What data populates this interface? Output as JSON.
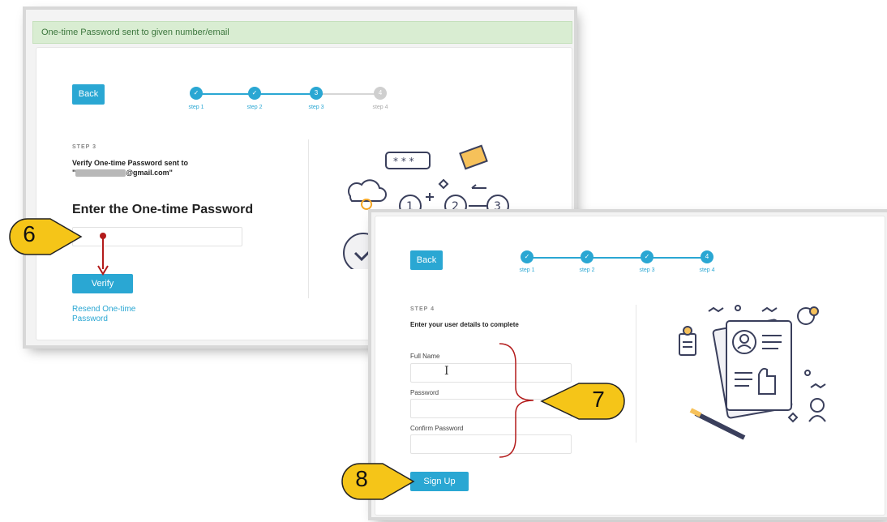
{
  "window1": {
    "alert_text": "One-time Password sent to given number/email",
    "back_label": "Back",
    "steps": [
      {
        "label": "step 1",
        "state": "done"
      },
      {
        "label": "step 2",
        "state": "done"
      },
      {
        "label": "step 3",
        "state": "current",
        "num": "3"
      },
      {
        "label": "step 4",
        "state": "todo",
        "num": "4"
      }
    ],
    "step_heading": "STEP 3",
    "verify_line1": "Verify One-time Password sent to",
    "verify_line2_suffix": "@gmail.com\"",
    "verify_line2_prefix": "\"",
    "title": "Enter the One-time Password",
    "otp_value": "",
    "verify_label": "Verify",
    "resend_label": "Resend One-time Password"
  },
  "window2": {
    "back_label": "Back",
    "steps": [
      {
        "label": "step 1",
        "state": "done"
      },
      {
        "label": "step 2",
        "state": "done"
      },
      {
        "label": "step 3",
        "state": "done"
      },
      {
        "label": "step 4",
        "state": "current",
        "num": "4"
      }
    ],
    "step_heading": "STEP 4",
    "instruction": "Enter your user details to complete",
    "fields": [
      {
        "label": "Full Name",
        "value": ""
      },
      {
        "label": "Password",
        "value": ""
      },
      {
        "label": "Confirm Password",
        "value": ""
      }
    ],
    "signup_label": "Sign Up"
  },
  "callouts": [
    {
      "number": "6",
      "color": "#f5c518"
    },
    {
      "number": "7",
      "color": "#f5c518"
    },
    {
      "number": "8",
      "color": "#f5c518"
    }
  ],
  "colors": {
    "accent": "#2aa7d3",
    "annotation_red": "#b31b1b",
    "alert_bg": "#d9edd2"
  }
}
